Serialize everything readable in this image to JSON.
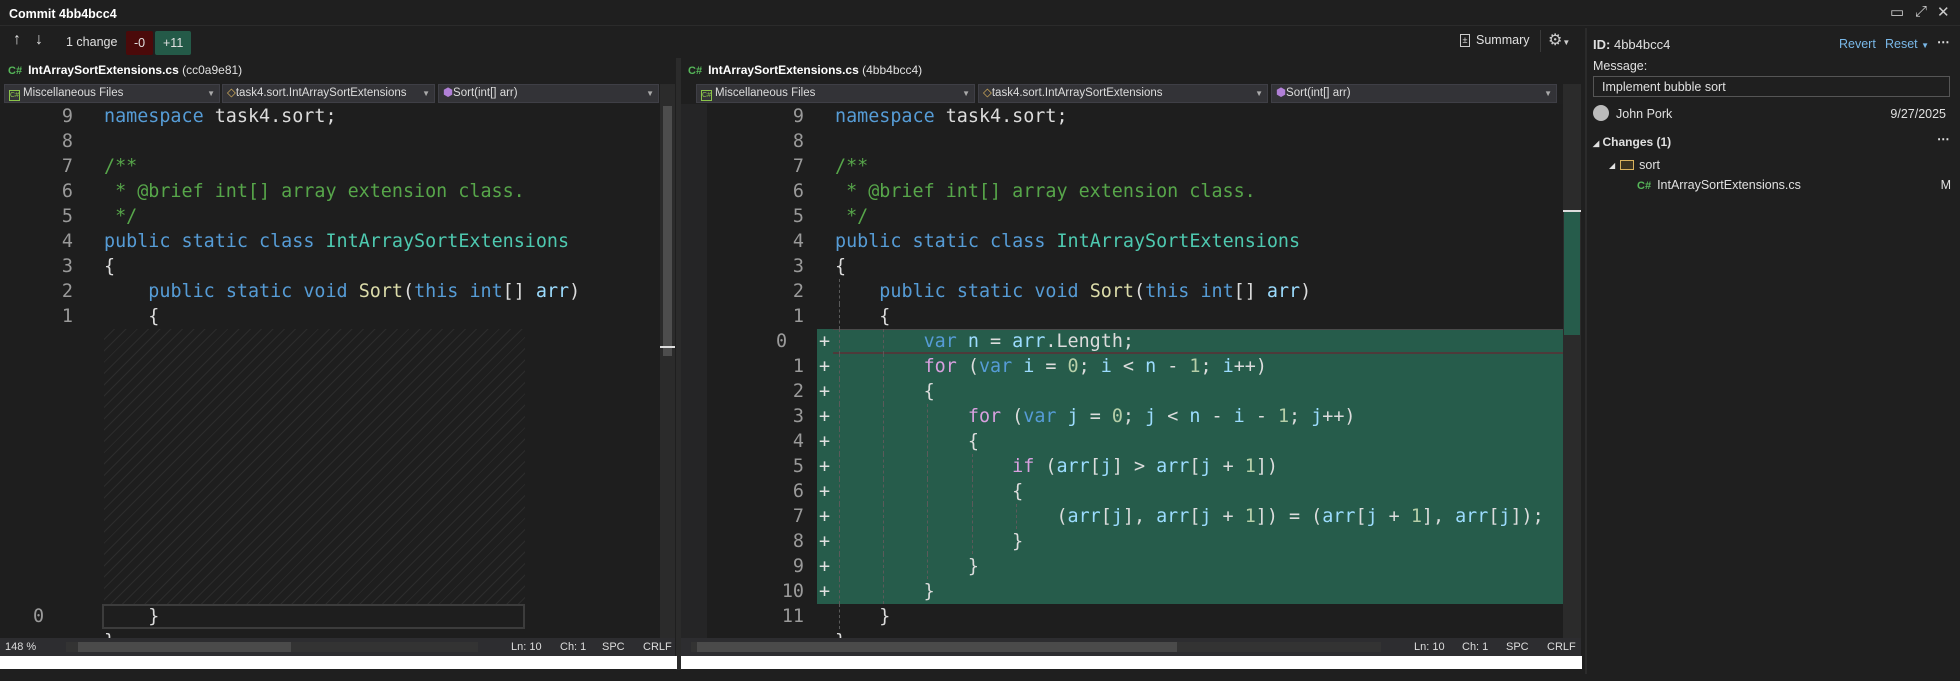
{
  "window": {
    "title": "Commit 4bb4bcc4",
    "icons": [
      "dock-icon",
      "maximize-icon",
      "close-icon"
    ]
  },
  "toolbar": {
    "change_count": "1 change",
    "removed": "-0",
    "added": "+11",
    "summary": "Summary"
  },
  "left": {
    "file": "IntArraySortExtensions.cs",
    "commit": "(cc0a9e81)",
    "project": "Miscellaneous Files",
    "type": "task4.sort.IntArraySortExtensions",
    "member": "Sort(int[] arr)",
    "padding_rows": 11,
    "lines": [
      {
        "n": "9",
        "t": [
          [
            "namespace",
            "kw"
          ],
          [
            " task4.sort;",
            "tx"
          ]
        ]
      },
      {
        "n": "8",
        "t": []
      },
      {
        "n": "7",
        "t": [
          [
            "/**",
            "cm"
          ]
        ]
      },
      {
        "n": "6",
        "t": [
          [
            " * @brief int[] array extension class.",
            "cm"
          ]
        ]
      },
      {
        "n": "5",
        "t": [
          [
            " */",
            "cm"
          ]
        ]
      },
      {
        "n": "4",
        "t": [
          [
            "public",
            "kw"
          ],
          [
            " ",
            ""
          ],
          [
            "static",
            "kw"
          ],
          [
            " ",
            ""
          ],
          [
            "class",
            "kw"
          ],
          [
            " ",
            ""
          ],
          [
            "IntArraySortExtensions",
            "cls"
          ]
        ]
      },
      {
        "n": "3",
        "t": [
          [
            "{",
            "tx"
          ]
        ]
      },
      {
        "n": "2",
        "t": [
          [
            "    ",
            ""
          ],
          [
            "public",
            "kw"
          ],
          [
            " ",
            ""
          ],
          [
            "static",
            "kw"
          ],
          [
            " ",
            ""
          ],
          [
            "void",
            "kw"
          ],
          [
            " ",
            ""
          ],
          [
            "Sort",
            "fn"
          ],
          [
            "(",
            "tx"
          ],
          [
            "this",
            "kw"
          ],
          [
            " ",
            ""
          ],
          [
            "int",
            "kw"
          ],
          [
            "[] ",
            "tx"
          ],
          [
            "arr",
            "id"
          ],
          [
            ")",
            "tx"
          ]
        ]
      },
      {
        "n": "1",
        "t": [
          [
            "    {",
            "tx"
          ]
        ]
      },
      {
        "n": "0",
        "cur": true,
        "t": [
          [
            "    }",
            "tx"
          ]
        ]
      },
      {
        "n": "",
        "t": [
          [
            "}",
            "tx"
          ]
        ]
      }
    ],
    "status": {
      "zoom": "148 %",
      "ln": "Ln: 10",
      "ch": "Ch: 1",
      "ws": "SPC",
      "eol": "CRLF"
    }
  },
  "right": {
    "file": "IntArraySortExtensions.cs",
    "commit": "(4bb4bcc4)",
    "project": "Miscellaneous Files",
    "type": "task4.sort.IntArraySortExtensions",
    "member": "Sort(int[] arr)",
    "lines": [
      {
        "n": "9",
        "t": [
          [
            "namespace",
            "kw"
          ],
          [
            " task4.sort;",
            "tx"
          ]
        ]
      },
      {
        "n": "8",
        "t": []
      },
      {
        "n": "7",
        "t": [
          [
            "/**",
            "cm"
          ]
        ]
      },
      {
        "n": "6",
        "t": [
          [
            " * @brief int[] array extension class.",
            "cm"
          ]
        ]
      },
      {
        "n": "5",
        "t": [
          [
            " */",
            "cm"
          ]
        ]
      },
      {
        "n": "4",
        "t": [
          [
            "public",
            "kw"
          ],
          [
            " ",
            ""
          ],
          [
            "static",
            "kw"
          ],
          [
            " ",
            ""
          ],
          [
            "class",
            "kw"
          ],
          [
            " ",
            ""
          ],
          [
            "IntArraySortExtensions",
            "cls"
          ]
        ]
      },
      {
        "n": "3",
        "t": [
          [
            "{",
            "tx"
          ]
        ]
      },
      {
        "n": "2",
        "t": [
          [
            "    ",
            ""
          ],
          [
            "public",
            "kw"
          ],
          [
            " ",
            ""
          ],
          [
            "static",
            "kw"
          ],
          [
            " ",
            ""
          ],
          [
            "void",
            "kw"
          ],
          [
            " ",
            ""
          ],
          [
            "Sort",
            "fn"
          ],
          [
            "(",
            "tx"
          ],
          [
            "this",
            "kw"
          ],
          [
            " ",
            ""
          ],
          [
            "int",
            "kw"
          ],
          [
            "[] ",
            "tx"
          ],
          [
            "arr",
            "id"
          ],
          [
            ")",
            "tx"
          ]
        ]
      },
      {
        "n": "1",
        "t": [
          [
            "    {",
            "tx"
          ]
        ]
      },
      {
        "n": "0",
        "cur": true,
        "add": true,
        "t": [
          [
            "        ",
            ""
          ],
          [
            "var",
            "kw"
          ],
          [
            " ",
            ""
          ],
          [
            "n",
            "id"
          ],
          [
            " = ",
            "tx"
          ],
          [
            "arr",
            "id"
          ],
          [
            ".Length;",
            "tx"
          ]
        ]
      },
      {
        "n": "1",
        "add": true,
        "t": [
          [
            "        ",
            ""
          ],
          [
            "for",
            "ctl"
          ],
          [
            " (",
            "tx"
          ],
          [
            "var",
            "kw"
          ],
          [
            " ",
            ""
          ],
          [
            "i",
            "id"
          ],
          [
            " = ",
            "tx"
          ],
          [
            "0",
            "num"
          ],
          [
            "; ",
            "tx"
          ],
          [
            "i",
            "id"
          ],
          [
            " < ",
            "tx"
          ],
          [
            "n",
            "id"
          ],
          [
            " - ",
            "tx"
          ],
          [
            "1",
            "num"
          ],
          [
            "; ",
            "tx"
          ],
          [
            "i",
            "id"
          ],
          [
            "++)",
            "tx"
          ]
        ]
      },
      {
        "n": "2",
        "add": true,
        "t": [
          [
            "        {",
            "tx"
          ]
        ]
      },
      {
        "n": "3",
        "add": true,
        "t": [
          [
            "            ",
            ""
          ],
          [
            "for",
            "ctl"
          ],
          [
            " (",
            "tx"
          ],
          [
            "var",
            "kw"
          ],
          [
            " ",
            ""
          ],
          [
            "j",
            "id"
          ],
          [
            " = ",
            "tx"
          ],
          [
            "0",
            "num"
          ],
          [
            "; ",
            "tx"
          ],
          [
            "j",
            "id"
          ],
          [
            " < ",
            "tx"
          ],
          [
            "n",
            "id"
          ],
          [
            " - ",
            "tx"
          ],
          [
            "i",
            "id"
          ],
          [
            " - ",
            "tx"
          ],
          [
            "1",
            "num"
          ],
          [
            "; ",
            "tx"
          ],
          [
            "j",
            "id"
          ],
          [
            "++)",
            "tx"
          ]
        ]
      },
      {
        "n": "4",
        "add": true,
        "t": [
          [
            "            {",
            "tx"
          ]
        ]
      },
      {
        "n": "5",
        "add": true,
        "t": [
          [
            "                ",
            ""
          ],
          [
            "if",
            "ctl"
          ],
          [
            " (",
            "tx"
          ],
          [
            "arr",
            "id"
          ],
          [
            "[",
            "tx"
          ],
          [
            "j",
            "id"
          ],
          [
            "] > ",
            "tx"
          ],
          [
            "arr",
            "id"
          ],
          [
            "[",
            "tx"
          ],
          [
            "j",
            "id"
          ],
          [
            " + ",
            "tx"
          ],
          [
            "1",
            "num"
          ],
          [
            "])",
            "tx"
          ]
        ]
      },
      {
        "n": "6",
        "add": true,
        "t": [
          [
            "                {",
            "tx"
          ]
        ]
      },
      {
        "n": "7",
        "add": true,
        "t": [
          [
            "                    (",
            "tx"
          ],
          [
            "arr",
            "id"
          ],
          [
            "[",
            "tx"
          ],
          [
            "j",
            "id"
          ],
          [
            "], ",
            "tx"
          ],
          [
            "arr",
            "id"
          ],
          [
            "[",
            "tx"
          ],
          [
            "j",
            "id"
          ],
          [
            " + ",
            "tx"
          ],
          [
            "1",
            "num"
          ],
          [
            "]) = (",
            "tx"
          ],
          [
            "arr",
            "id"
          ],
          [
            "[",
            "tx"
          ],
          [
            "j",
            "id"
          ],
          [
            " + ",
            "tx"
          ],
          [
            "1",
            "num"
          ],
          [
            "], ",
            "tx"
          ],
          [
            "arr",
            "id"
          ],
          [
            "[",
            "tx"
          ],
          [
            "j",
            "id"
          ],
          [
            "]);",
            "tx"
          ]
        ]
      },
      {
        "n": "8",
        "add": true,
        "t": [
          [
            "                }",
            "tx"
          ]
        ]
      },
      {
        "n": "9",
        "add": true,
        "t": [
          [
            "            }",
            "tx"
          ]
        ]
      },
      {
        "n": "10",
        "add": true,
        "t": [
          [
            "        }",
            "tx"
          ]
        ]
      },
      {
        "n": "11",
        "t": [
          [
            "    }",
            "tx"
          ]
        ]
      },
      {
        "n": "",
        "t": [
          [
            "}",
            "tx"
          ]
        ]
      }
    ],
    "status": {
      "ln": "Ln: 10",
      "ch": "Ch: 1",
      "ws": "SPC",
      "eol": "CRLF"
    }
  },
  "details": {
    "id_label": "ID:",
    "id": "4bb4bcc4",
    "revert": "Revert",
    "reset": "Reset",
    "message_label": "Message:",
    "message": "Implement bubble sort",
    "author": "John Pork",
    "date": "9/27/2025",
    "changes": "Changes (1)",
    "folder": "sort",
    "file": "IntArraySortExtensions.cs",
    "file_status": "M",
    "file_icon": "C#"
  }
}
